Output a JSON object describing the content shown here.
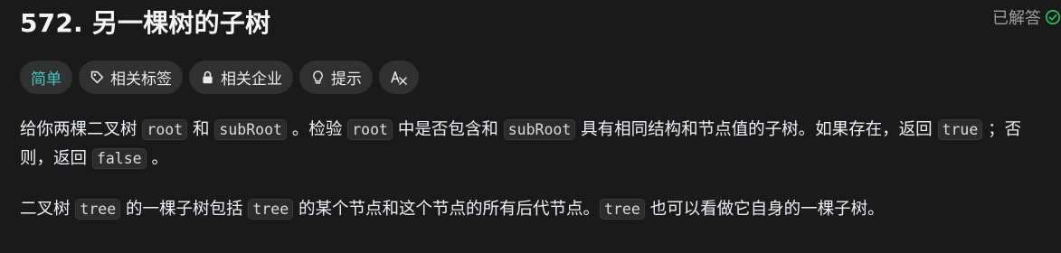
{
  "title": "572. 另一棵树的子树",
  "status": {
    "label": "已解答",
    "icon": "check-circle-icon"
  },
  "tags": [
    {
      "label": "简单",
      "icon": ""
    },
    {
      "label": "相关标签",
      "icon": "tag-icon"
    },
    {
      "label": "相关企业",
      "icon": "lock-icon"
    },
    {
      "label": "提示",
      "icon": "lightbulb-icon"
    },
    {
      "label": "",
      "icon": "translate-icon"
    }
  ],
  "description": {
    "p1": {
      "t1": "给你两棵二叉树 ",
      "c1": "root",
      "t2": " 和 ",
      "c2": "subRoot",
      "t3": " 。检验 ",
      "c3": "root",
      "t4": " 中是否包含和 ",
      "c4": "subRoot",
      "t5": " 具有相同结构和节点值的子树。如果存在，返回 ",
      "c5": "true",
      "t6": " ；否则，返回 ",
      "c6": "false",
      "t7": " 。"
    },
    "p2": {
      "t1": "二叉树 ",
      "c1": "tree",
      "t2": " 的一棵子树包括 ",
      "c2": "tree",
      "t3": " 的某个节点和这个节点的所有后代节点。",
      "c3": "tree",
      "t4": " 也可以看做它自身的一棵子树。"
    }
  },
  "colors": {
    "easy": "#46c6c2",
    "solved_check": "#2cbb5d",
    "bg": "#1a1a1a"
  }
}
